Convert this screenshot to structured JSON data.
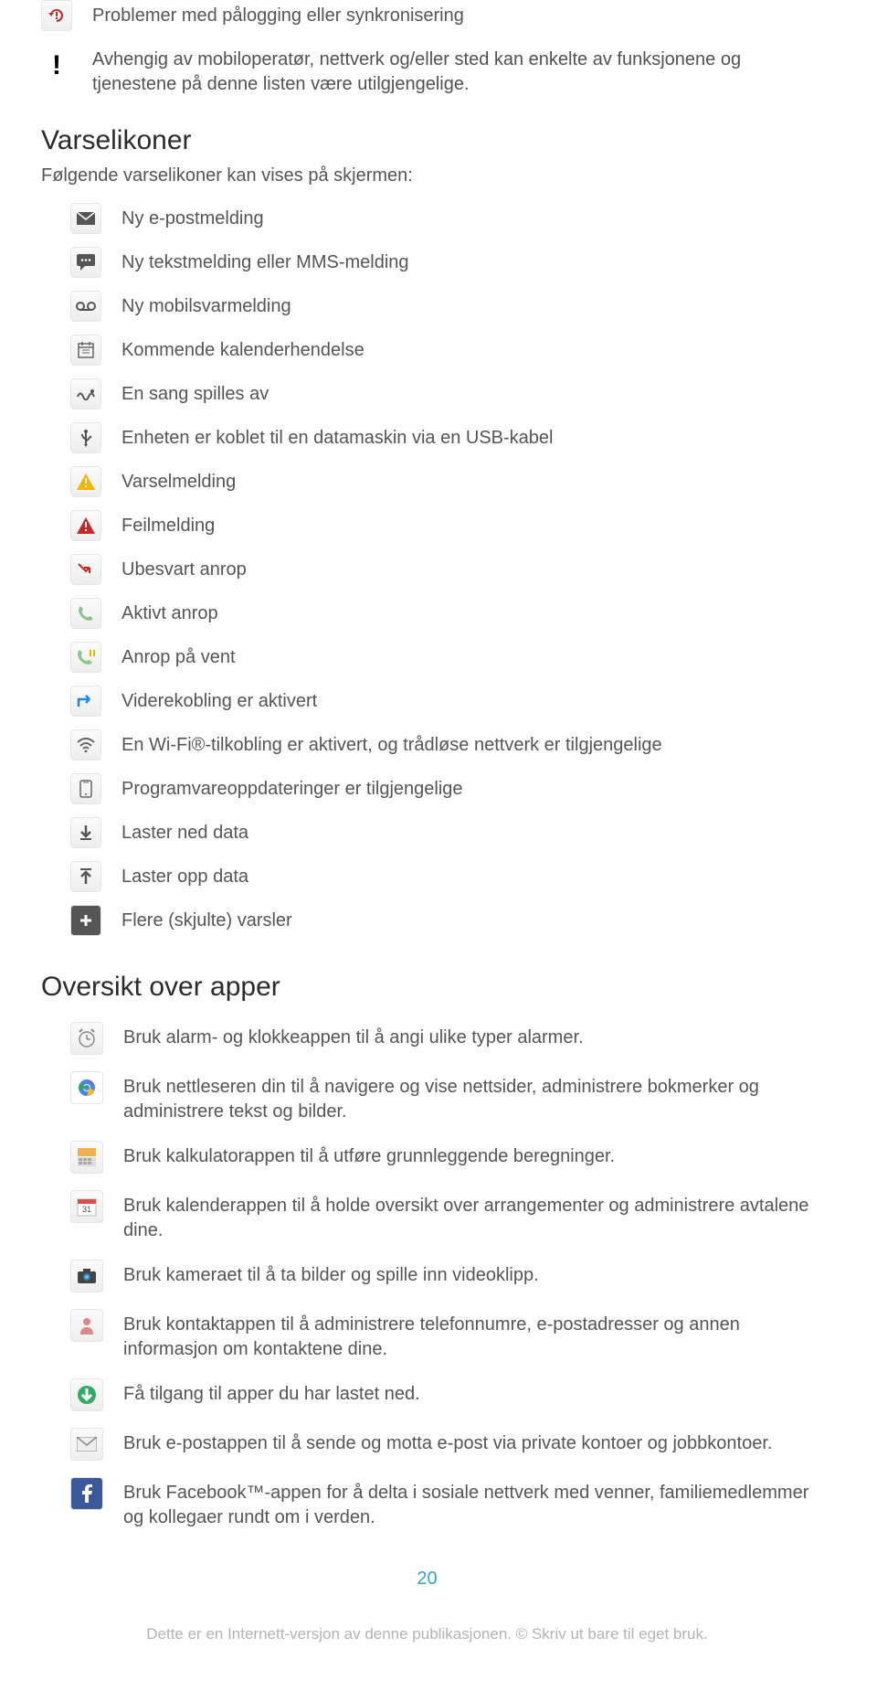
{
  "top_row": {
    "label": "Problemer med pålogging eller synkronisering"
  },
  "warning_note": "Avhengig av mobiloperatør, nettverk og/eller sted kan enkelte av funksjonene og tjenestene på denne listen være utilgjengelige.",
  "varselikoner": {
    "heading": "Varselikoner",
    "subhead": "Følgende varselikoner kan vises på skjermen:",
    "items": [
      "Ny e-postmelding",
      "Ny tekstmelding eller MMS-melding",
      "Ny mobilsvarmelding",
      "Kommende kalenderhendelse",
      "En sang spilles av",
      "Enheten er koblet til en datamaskin via en USB-kabel",
      "Varselmelding",
      "Feilmelding",
      "Ubesvart anrop",
      "Aktivt anrop",
      "Anrop på vent",
      "Viderekobling er aktivert",
      "En Wi-Fi®-tilkobling er aktivert, og trådløse nettverk er tilgjengelige",
      "Programvareoppdateringer er tilgjengelige",
      "Laster ned data",
      "Laster opp data",
      "Flere (skjulte) varsler"
    ]
  },
  "apps": {
    "heading": "Oversikt over apper",
    "items": [
      "Bruk alarm- og klokkeappen til å angi ulike typer alarmer.",
      "Bruk nettleseren din til å navigere og vise nettsider, administrere bokmerker og administrere tekst og bilder.",
      "Bruk kalkulatorappen til å utføre grunnleggende beregninger.",
      "Bruk kalenderappen til å holde oversikt over arrangementer og administrere avtalene dine.",
      "Bruk kameraet til å ta bilder og spille inn videoklipp.",
      "Bruk kontaktappen til å administrere telefonnumre, e-postadresser og annen informasjon om kontaktene dine.",
      "Få tilgang til apper du har lastet ned.",
      "Bruk e-postappen til å sende og motta e-post via private kontoer og jobbkontoer.",
      "Bruk Facebook™-appen for å delta i sosiale nettverk med venner, familiemedlemmer og kollegaer rundt om i verden."
    ]
  },
  "page_number": "20",
  "footer": "Dette er en Internett-versjon av denne publikasjonen. © Skriv ut bare til eget bruk."
}
